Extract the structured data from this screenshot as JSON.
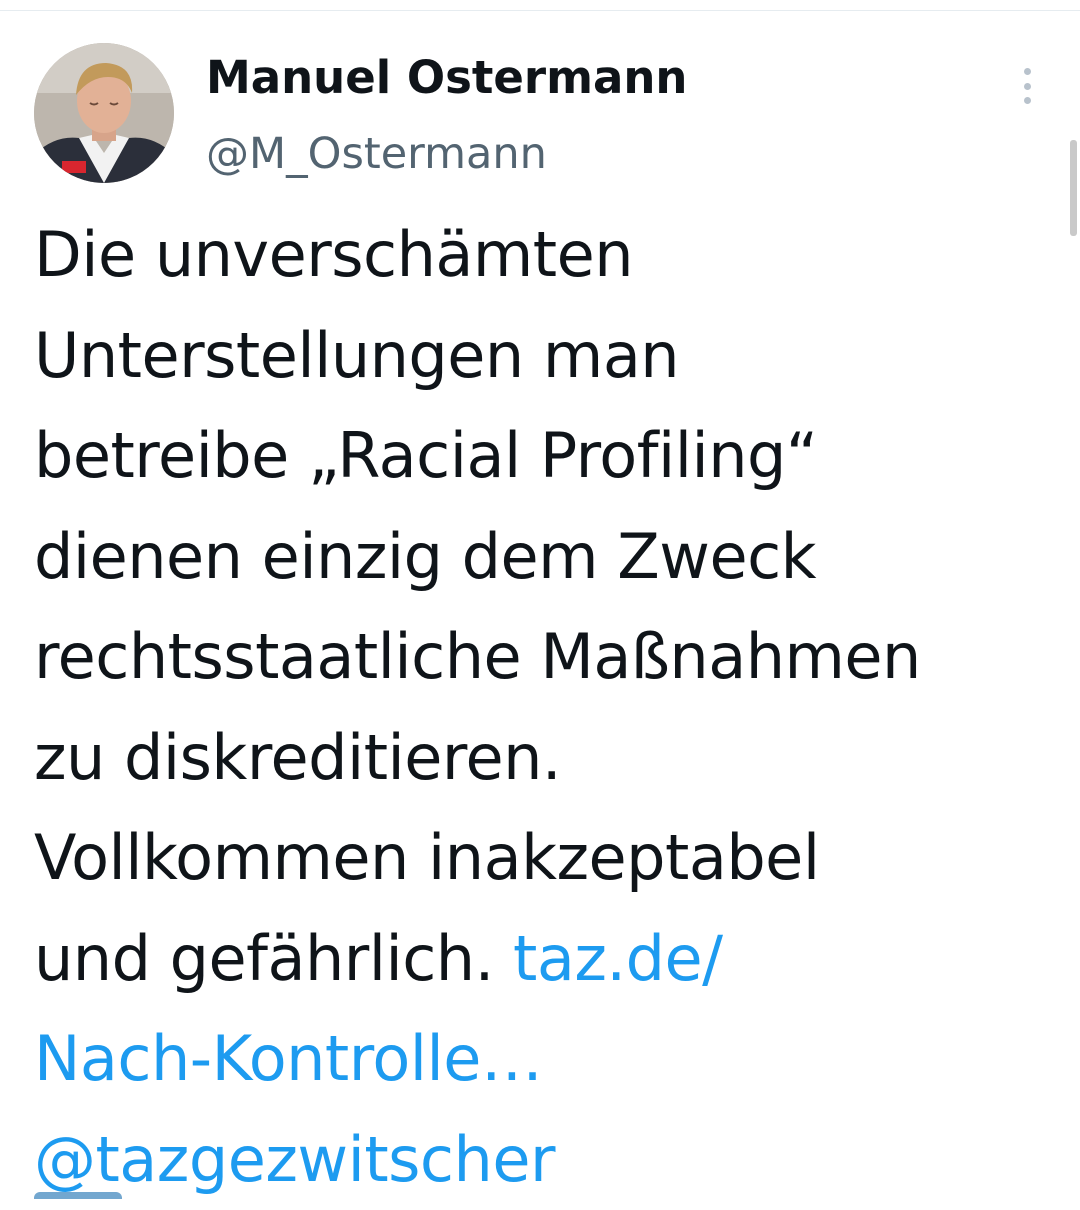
{
  "author": {
    "display_name": "Manuel Ostermann",
    "handle": "@M_Ostermann"
  },
  "icons": {
    "more": "more-vertical-icon",
    "avatar": "profile-photo"
  },
  "tweet": {
    "lines": [
      "Die unverschämten",
      "Unterstellungen man",
      "betreibe „Racial Profiling“",
      "dienen einzig dem Zweck",
      "rechtsstaatliche Maßnahmen",
      "zu diskreditieren.",
      "Vollkommen inakzeptabel"
    ],
    "line8_text": "und gefährlich.",
    "link_part1": "taz.de/",
    "link_part2": "Nach-Kontrolle…",
    "mention": "@tazgezwitscher"
  },
  "colors": {
    "text": "#0f1419",
    "secondary": "#536471",
    "link": "#1d9bf0"
  }
}
